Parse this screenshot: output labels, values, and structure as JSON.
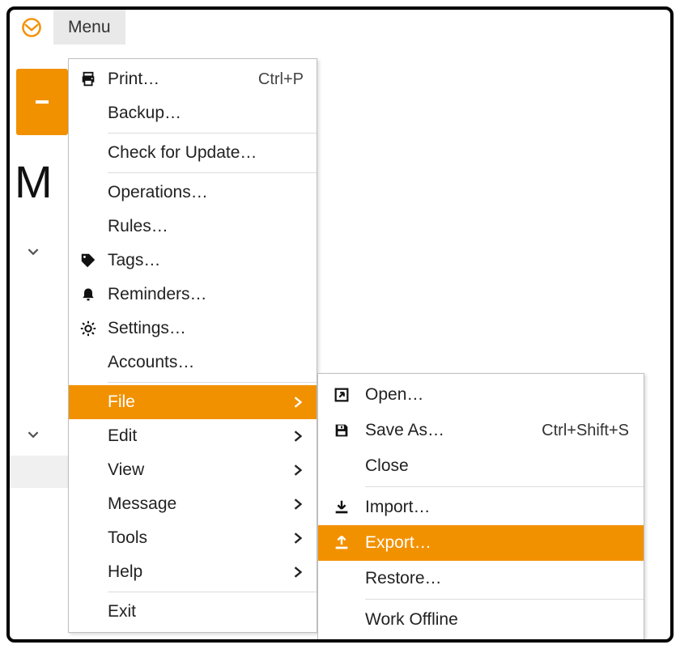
{
  "topbar": {
    "menu_label": "Menu"
  },
  "heading_fragment": "M",
  "colors": {
    "accent": "#f29100"
  },
  "main_menu": {
    "items": [
      {
        "icon": "print-icon",
        "label": "Print…",
        "shortcut": "Ctrl+P"
      },
      {
        "icon": "",
        "label": "Backup…",
        "shortcut": ""
      },
      {
        "sep": true
      },
      {
        "icon": "",
        "label": "Check for Update…",
        "shortcut": ""
      },
      {
        "sep": true
      },
      {
        "icon": "",
        "label": "Operations…",
        "shortcut": ""
      },
      {
        "icon": "",
        "label": "Rules…",
        "shortcut": ""
      },
      {
        "icon": "tag-icon",
        "label": "Tags…",
        "shortcut": ""
      },
      {
        "icon": "bell-icon",
        "label": "Reminders…",
        "shortcut": ""
      },
      {
        "icon": "gear-icon",
        "label": "Settings…",
        "shortcut": ""
      },
      {
        "icon": "",
        "label": "Accounts…",
        "shortcut": ""
      },
      {
        "sep": true
      },
      {
        "icon": "",
        "label": "File",
        "submenu": true,
        "selected": true
      },
      {
        "icon": "",
        "label": "Edit",
        "submenu": true
      },
      {
        "icon": "",
        "label": "View",
        "submenu": true
      },
      {
        "icon": "",
        "label": "Message",
        "submenu": true
      },
      {
        "icon": "",
        "label": "Tools",
        "submenu": true
      },
      {
        "icon": "",
        "label": "Help",
        "submenu": true
      },
      {
        "sep": true
      },
      {
        "icon": "",
        "label": "Exit",
        "shortcut": ""
      }
    ]
  },
  "sub_menu": {
    "items": [
      {
        "icon": "open-icon",
        "label": "Open…",
        "shortcut": ""
      },
      {
        "icon": "save-icon",
        "label": "Save As…",
        "shortcut": "Ctrl+Shift+S"
      },
      {
        "icon": "",
        "label": "Close",
        "shortcut": ""
      },
      {
        "sep": true
      },
      {
        "icon": "import-icon",
        "label": "Import…",
        "shortcut": ""
      },
      {
        "icon": "export-icon",
        "label": "Export…",
        "shortcut": "",
        "selected": true
      },
      {
        "icon": "",
        "label": "Restore…",
        "shortcut": ""
      },
      {
        "sep": true
      },
      {
        "icon": "",
        "label": "Work Offline",
        "shortcut": ""
      }
    ]
  }
}
